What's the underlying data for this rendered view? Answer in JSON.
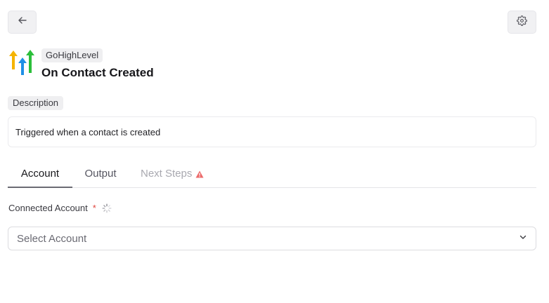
{
  "header": {
    "back_icon": "arrow-left-icon",
    "settings_icon": "gear-icon"
  },
  "app": {
    "name": "GoHighLevel",
    "logo_icon": "gohighlevel-logo-icon",
    "trigger_title": "On Contact Created",
    "logo_colors": [
      "#f5b400",
      "#1f8fe6",
      "#2bbf3a"
    ]
  },
  "description": {
    "label": "Description",
    "text": "Triggered when a contact is created"
  },
  "tabs": [
    {
      "label": "Account",
      "active": true
    },
    {
      "label": "Output",
      "active": false
    },
    {
      "label": "Next Steps",
      "active": false,
      "warning": true
    }
  ],
  "account_field": {
    "label": "Connected Account",
    "required_mark": "*",
    "loading": true,
    "select_placeholder": "Select Account"
  }
}
